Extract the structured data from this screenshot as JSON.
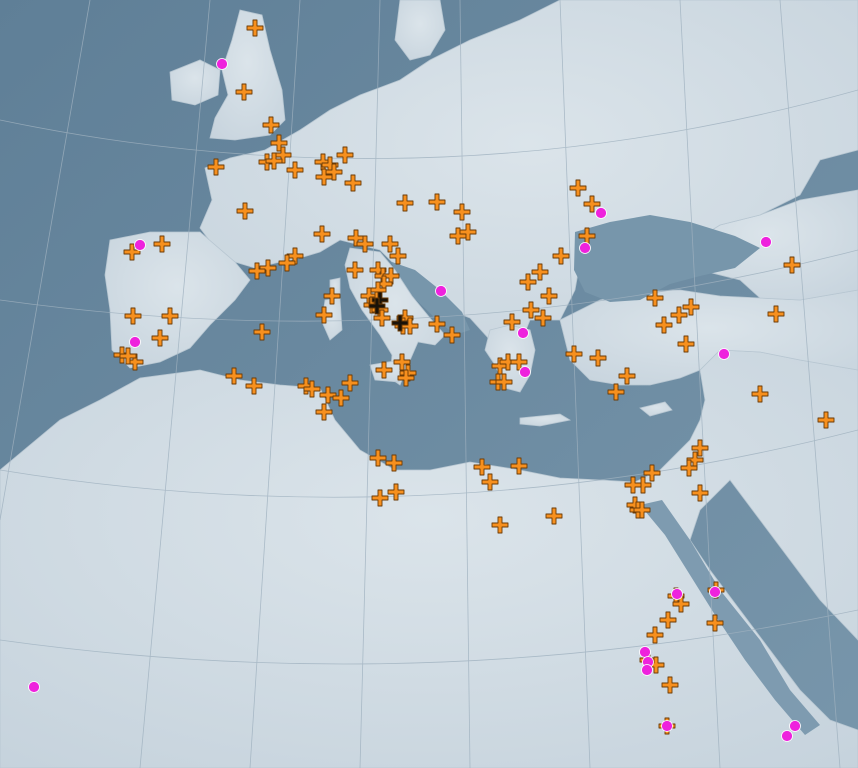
{
  "map": {
    "colors": {
      "sea": "#6f8da3",
      "land": "#d3dee6",
      "graticule": "#8fa3b3",
      "cross_fill": "#f7901e",
      "cross_outline": "#6b3a05",
      "cross_highlight": "#1a1208",
      "dot_fill": "#ee22dd",
      "dot_outline": "#ffffff"
    },
    "icons": {
      "cross": "plus-marker-icon",
      "dot": "circle-marker-icon"
    }
  }
}
